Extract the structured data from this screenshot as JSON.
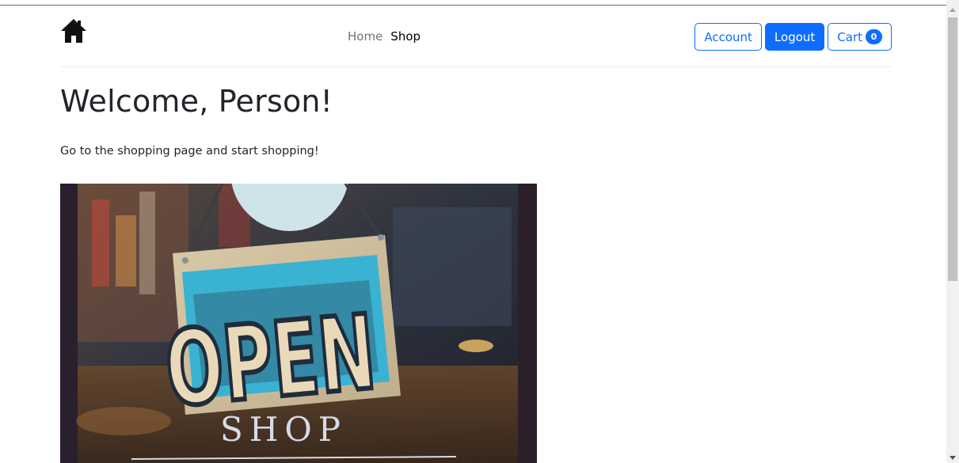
{
  "navbar": {
    "logo_icon": "house-icon",
    "links": [
      {
        "label": "Home",
        "active": false
      },
      {
        "label": "Shop",
        "active": true
      }
    ],
    "account_label": "Account",
    "logout_label": "Logout",
    "cart_label": "Cart",
    "cart_count": "0"
  },
  "main": {
    "heading": "Welcome, Person!",
    "intro": "Go to the shopping page and start shopping!",
    "hero": {
      "sign_text": "OPEN",
      "window_text": "SHOP"
    }
  },
  "colors": {
    "primary": "#0d6efd",
    "text": "#212529",
    "muted": "#6c757d"
  }
}
